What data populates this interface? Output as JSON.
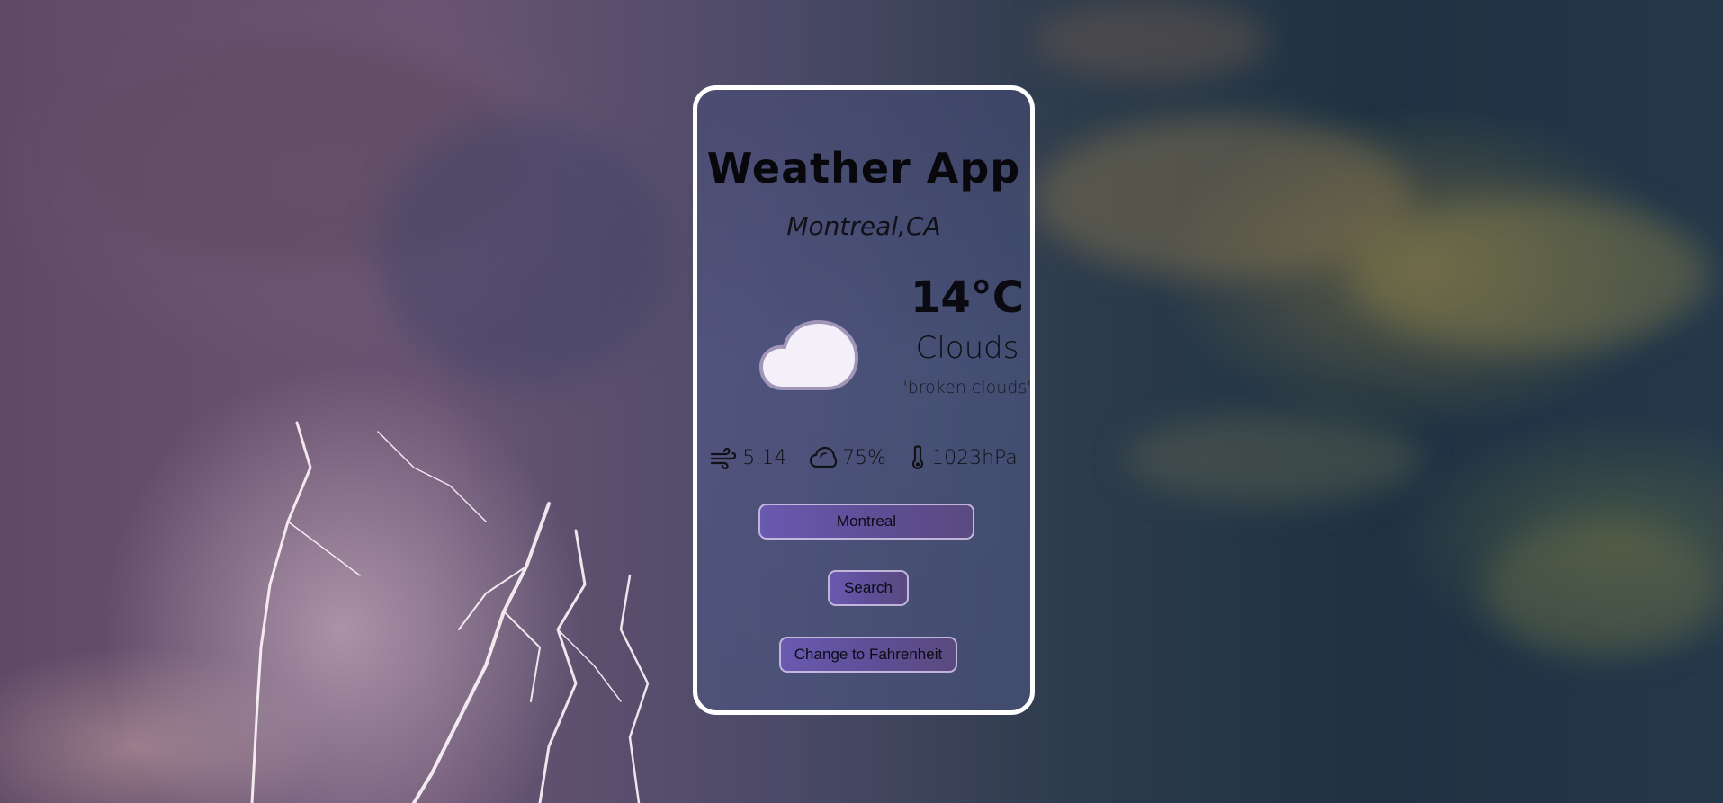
{
  "app": {
    "title": "Weather App",
    "location": "Montreal,CA"
  },
  "current": {
    "icon": "cloud-icon",
    "temperature": "14°C",
    "condition": "Clouds",
    "description": "\"broken clouds\""
  },
  "stats": {
    "wind": {
      "icon": "wind-icon",
      "value": "5.14"
    },
    "cloudiness": {
      "icon": "cloudiness-icon",
      "value": "75%"
    },
    "pressure": {
      "icon": "thermometer-icon",
      "value": "1023hPa"
    }
  },
  "search": {
    "input_value": "Montreal",
    "button_label": "Search"
  },
  "units": {
    "toggle_label": "Change to Fahrenheit"
  },
  "colors": {
    "card_border": "#ffffff",
    "button_gradient_start": "#6a5ab0",
    "button_gradient_end": "#5a4a80",
    "text": "#0a0a10"
  }
}
